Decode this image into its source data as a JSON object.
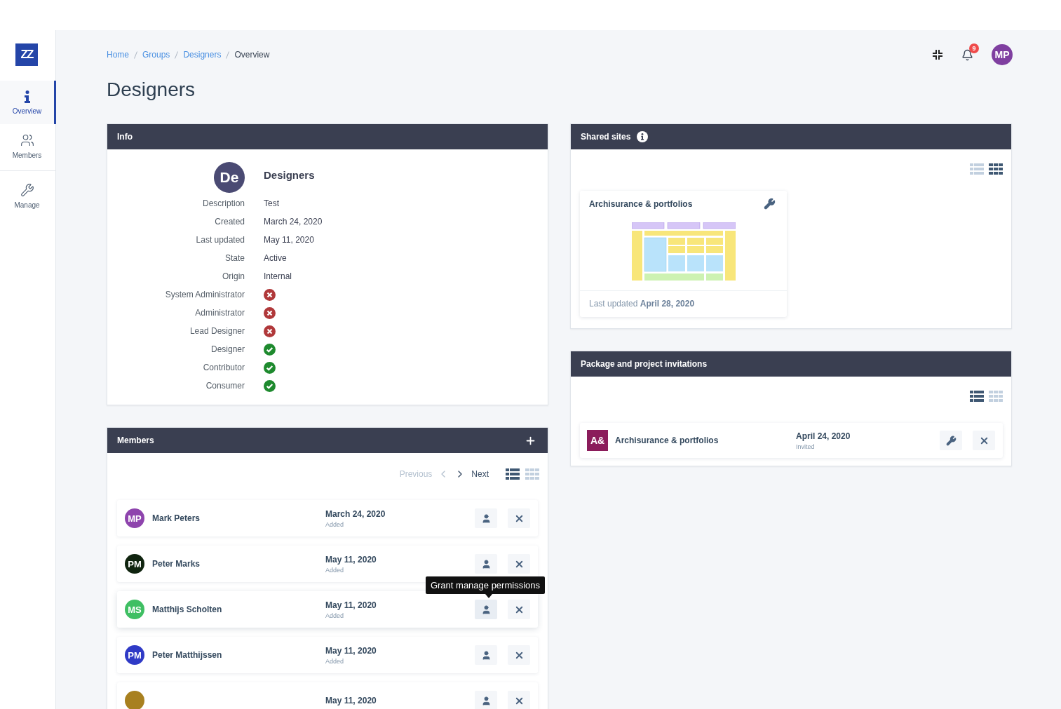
{
  "sidebar": {
    "logo": "ZZ",
    "items": [
      {
        "kind": "info",
        "label": "Overview",
        "selected": true
      },
      {
        "kind": "users",
        "label": "Members",
        "selected": false
      },
      {
        "kind": "wrench",
        "label": "Manage",
        "selected": false
      }
    ]
  },
  "breadcrumb": [
    {
      "label": "Home",
      "current": false
    },
    {
      "label": "Groups",
      "current": false
    },
    {
      "label": "Designers",
      "current": false
    },
    {
      "label": "Overview",
      "current": true
    }
  ],
  "topbar": {
    "notification_count": "9",
    "user_initials": "MP"
  },
  "title": "Designers",
  "info": {
    "title": "Info",
    "avatar": "De",
    "name": "Designers",
    "fields": [
      {
        "label": "Description",
        "value": "Test"
      },
      {
        "label": "Created",
        "value": "March 24, 2020"
      },
      {
        "label": "Last updated",
        "value": "May 11, 2020"
      },
      {
        "label": "State",
        "value": "Active"
      },
      {
        "label": "Origin",
        "value": "Internal"
      }
    ],
    "roles": [
      {
        "label": "System Administrator",
        "granted": false
      },
      {
        "label": "Administrator",
        "granted": false
      },
      {
        "label": "Lead Designer",
        "granted": false
      },
      {
        "label": "Designer",
        "granted": true
      },
      {
        "label": "Contributor",
        "granted": true
      },
      {
        "label": "Consumer",
        "granted": true
      }
    ]
  },
  "members": {
    "title": "Members",
    "previous": "Previous",
    "previous_disabled": true,
    "next": "Next",
    "views": [
      {
        "kind": "list",
        "selected": true
      },
      {
        "kind": "grid",
        "selected": false
      }
    ],
    "rows": [
      {
        "initials": "MP",
        "name": "Mark Peters",
        "color": "#8e44ad",
        "date": "March 24, 2020",
        "status": "Added",
        "hovered": false
      },
      {
        "initials": "PM",
        "name": "Peter Marks",
        "color": "#10240f",
        "date": "May 11, 2020",
        "status": "Added",
        "hovered": false
      },
      {
        "initials": "MS",
        "name": "Matthijs Scholten",
        "color": "#3fbf63",
        "date": "May 11, 2020",
        "status": "Added",
        "hovered": true,
        "tooltip": "Grant manage permissions"
      },
      {
        "initials": "PM",
        "name": "Peter Matthijssen",
        "color": "#2f3ac6",
        "date": "May 11, 2020",
        "status": "Added",
        "hovered": false
      },
      {
        "color": "#a8801f",
        "date": "May 11, 2020",
        "hovered": false
      }
    ]
  },
  "shared_sites": {
    "title": "Shared sites",
    "views": [
      {
        "kind": "list",
        "selected": false
      },
      {
        "kind": "grid",
        "selected": true
      }
    ],
    "sites": [
      {
        "title": "Archisurance & portfolios",
        "updated": "Last updated **April 28, 2020**"
      }
    ]
  },
  "invitations": {
    "title": "Package and project invitations",
    "views": [
      {
        "kind": "list",
        "selected": true
      },
      {
        "kind": "grid",
        "selected": false
      }
    ],
    "items": [
      {
        "initials": "A&",
        "name": "Archisurance & portfolios",
        "color": "#8b1c5b",
        "date": "April 24, 2020",
        "status": "Invited"
      }
    ]
  }
}
